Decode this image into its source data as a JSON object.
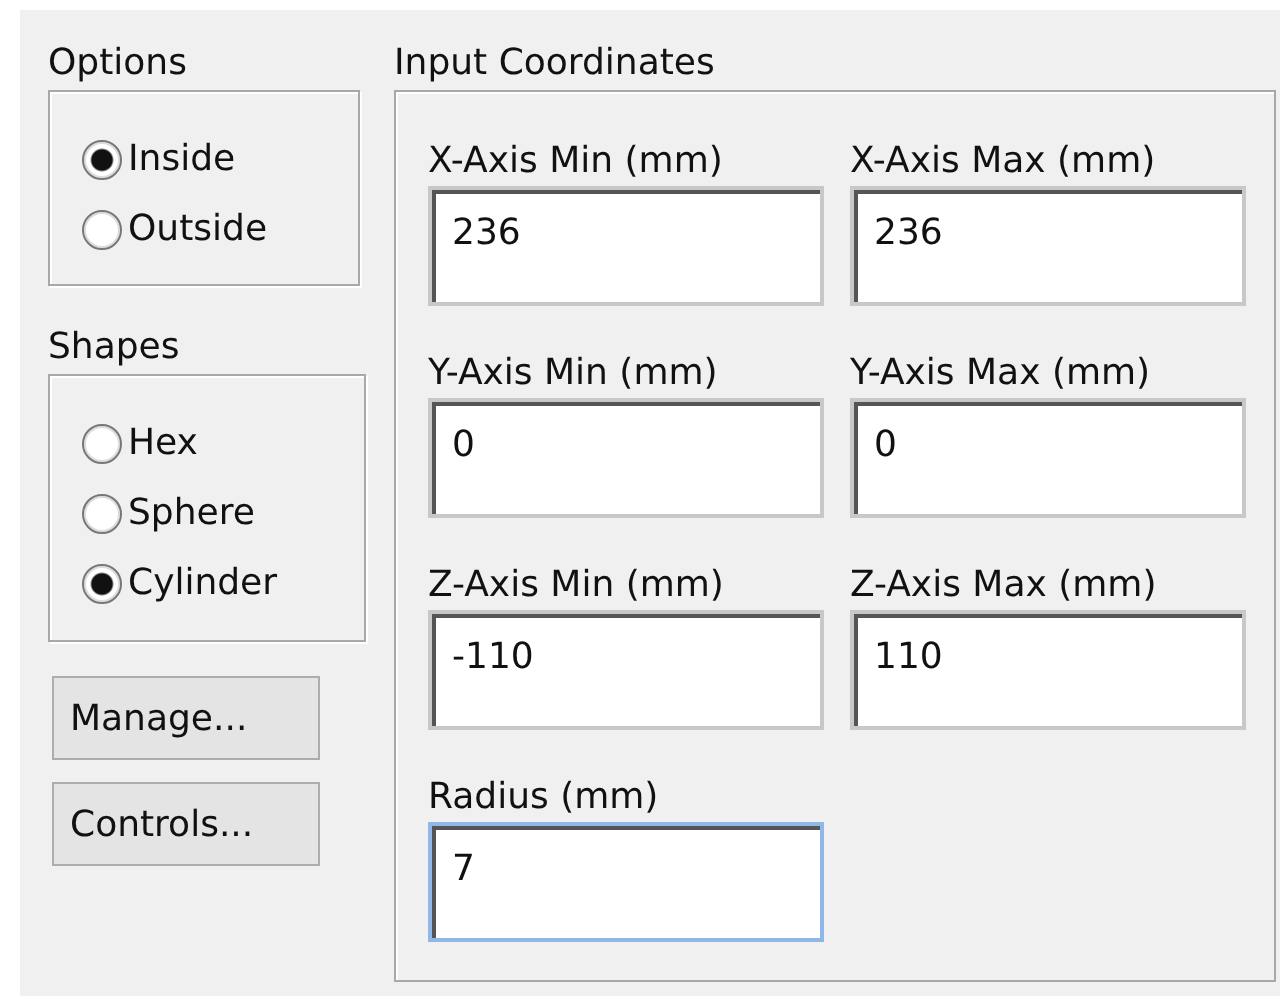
{
  "options": {
    "title": "Options",
    "items": [
      {
        "label": "Inside",
        "selected": true
      },
      {
        "label": "Outside",
        "selected": false
      }
    ]
  },
  "shapes": {
    "title": "Shapes",
    "items": [
      {
        "label": "Hex",
        "selected": false
      },
      {
        "label": "Sphere",
        "selected": false
      },
      {
        "label": "Cylinder",
        "selected": true
      }
    ]
  },
  "buttons": [
    "Manage...",
    "Controls..."
  ],
  "coordinates": {
    "title": "Input Coordinates",
    "fields": [
      {
        "label": "X-Axis Min (mm)",
        "value": "236",
        "focused": false
      },
      {
        "label": "X-Axis Max (mm)",
        "value": "236",
        "focused": false
      },
      {
        "label": "Y-Axis Min (mm)",
        "value": "0",
        "focused": false
      },
      {
        "label": "Y-Axis Max (mm)",
        "value": "0",
        "focused": false
      },
      {
        "label": "Z-Axis Min (mm)",
        "value": "-110",
        "focused": false
      },
      {
        "label": "Z-Axis Max (mm)",
        "value": "110",
        "focused": false
      },
      {
        "label": "Radius (mm)",
        "value": "7",
        "focused": true
      }
    ]
  }
}
